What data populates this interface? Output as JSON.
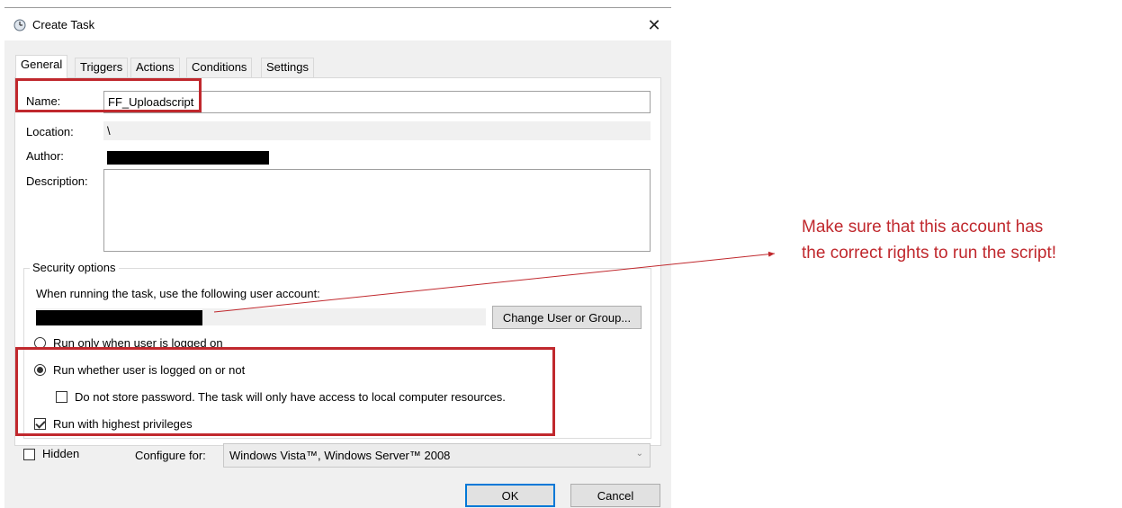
{
  "window": {
    "title": "Create Task",
    "icon": "clock-icon",
    "close_glyph": "✕"
  },
  "tabs": [
    {
      "label": "General",
      "active": true
    },
    {
      "label": "Triggers",
      "active": false
    },
    {
      "label": "Actions",
      "active": false
    },
    {
      "label": "Conditions",
      "active": false
    },
    {
      "label": "Settings",
      "active": false
    }
  ],
  "general": {
    "name_label": "Name:",
    "name_value": "FF_Uploadscript",
    "location_label": "Location:",
    "location_value": "\\",
    "author_label": "Author:",
    "description_label": "Description:",
    "description_value": ""
  },
  "security": {
    "group_title": "Security options",
    "account_prompt": "When running the task, use the following user account:",
    "change_button": "Change User or Group...",
    "radio_logged_on": "Run only when user is logged on",
    "radio_logged_on_checked": false,
    "radio_whether": "Run whether user is logged on or not",
    "radio_whether_checked": true,
    "no_store_password": "Do not store password.  The task will only have access to local computer resources.",
    "no_store_password_checked": false,
    "highest_privileges": "Run with highest privileges",
    "highest_privileges_checked": true
  },
  "bottom": {
    "hidden_label": "Hidden",
    "hidden_checked": false,
    "configure_label": "Configure for:",
    "configure_value": "Windows Vista™, Windows Server™ 2008"
  },
  "buttons": {
    "ok": "OK",
    "cancel": "Cancel"
  },
  "annotation": {
    "text_line1": "Make sure that this account has",
    "text_line2": "the correct rights to run the script!",
    "color": "#c0282d"
  },
  "colors": {
    "highlight_red": "#c0282d",
    "focus_blue": "#0078d7",
    "dialog_bg": "#f0f0f0"
  }
}
